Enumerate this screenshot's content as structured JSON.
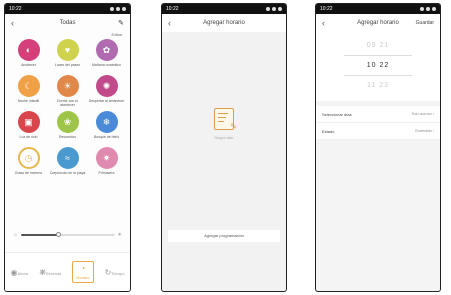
{
  "status_bar": {
    "phone1_time": "10:22",
    "phone2_time": "10:22",
    "phone3_time": "10:22"
  },
  "scenes_screen": {
    "title": "Todas",
    "edit_label": "Editar",
    "scenes": [
      {
        "label": "Anoitecer",
        "color": "#d6407a",
        "icon": "sunset-icon",
        "glyph": "◐"
      },
      {
        "label": "Luces del paseo",
        "color": "#cfd24c",
        "icon": "heart-icon",
        "glyph": "♥"
      },
      {
        "label": "Mañana romántico",
        "color": "#b06bb0",
        "icon": "flower-icon",
        "glyph": "✿"
      },
      {
        "label": "Noche infantil",
        "color": "#f0a046",
        "icon": "moon-icon",
        "glyph": "☾"
      },
      {
        "label": "Dormir con el atardecer",
        "color": "#e0884a",
        "icon": "sunrise-icon",
        "glyph": "☀"
      },
      {
        "label": "Despertar al amanecer",
        "color": "#c04a8a",
        "icon": "dawn-icon",
        "glyph": "✺"
      },
      {
        "label": "Luz de ocio",
        "color": "#d8454a",
        "icon": "gift-icon",
        "glyph": "▣"
      },
      {
        "label": "Recuerdos",
        "color": "#9fc44a",
        "icon": "leaf-icon",
        "glyph": "❀"
      },
      {
        "label": "Bosque de hielo",
        "color": "#4a8ad8",
        "icon": "snowflake-icon",
        "glyph": "❄"
      },
      {
        "label": "Gotas de invierno",
        "color": "#ffffff",
        "icon": "clock-icon",
        "glyph": "◷",
        "outline": true
      },
      {
        "label": "Crepúsculo en la playa",
        "color": "#4a9ad0",
        "icon": "wave-icon",
        "glyph": "≈"
      },
      {
        "label": "Primavera",
        "color": "#e08ab0",
        "icon": "star-icon",
        "glyph": "✷"
      }
    ],
    "brightness_percent": 40,
    "tabs": [
      {
        "label": "Ahora",
        "icon": "bulb-icon",
        "glyph": "◉",
        "active": false
      },
      {
        "label": "Escenas",
        "icon": "palette-icon",
        "glyph": "❋",
        "active": false
      },
      {
        "label": "Horario",
        "icon": "timer-icon",
        "glyph": "◔",
        "active": true
      },
      {
        "label": "Tiempo",
        "icon": "refresh-icon",
        "glyph": "↻",
        "active": false
      }
    ]
  },
  "schedule_list_screen": {
    "title": "Agregar horario",
    "empty_text": "Ningún dato",
    "add_button": "Agregar programación"
  },
  "schedule_edit_screen": {
    "title": "Agregar horario",
    "save_label": "Guardar",
    "time_rows": [
      {
        "value": "09  21",
        "selected": false
      },
      {
        "value": "10  22",
        "selected": true
      },
      {
        "value": "11  23",
        "selected": false
      }
    ],
    "settings": [
      {
        "label": "Seleccionar días",
        "value": "Sólo una vez"
      },
      {
        "label": "Estado",
        "value": "Encendido"
      }
    ]
  }
}
